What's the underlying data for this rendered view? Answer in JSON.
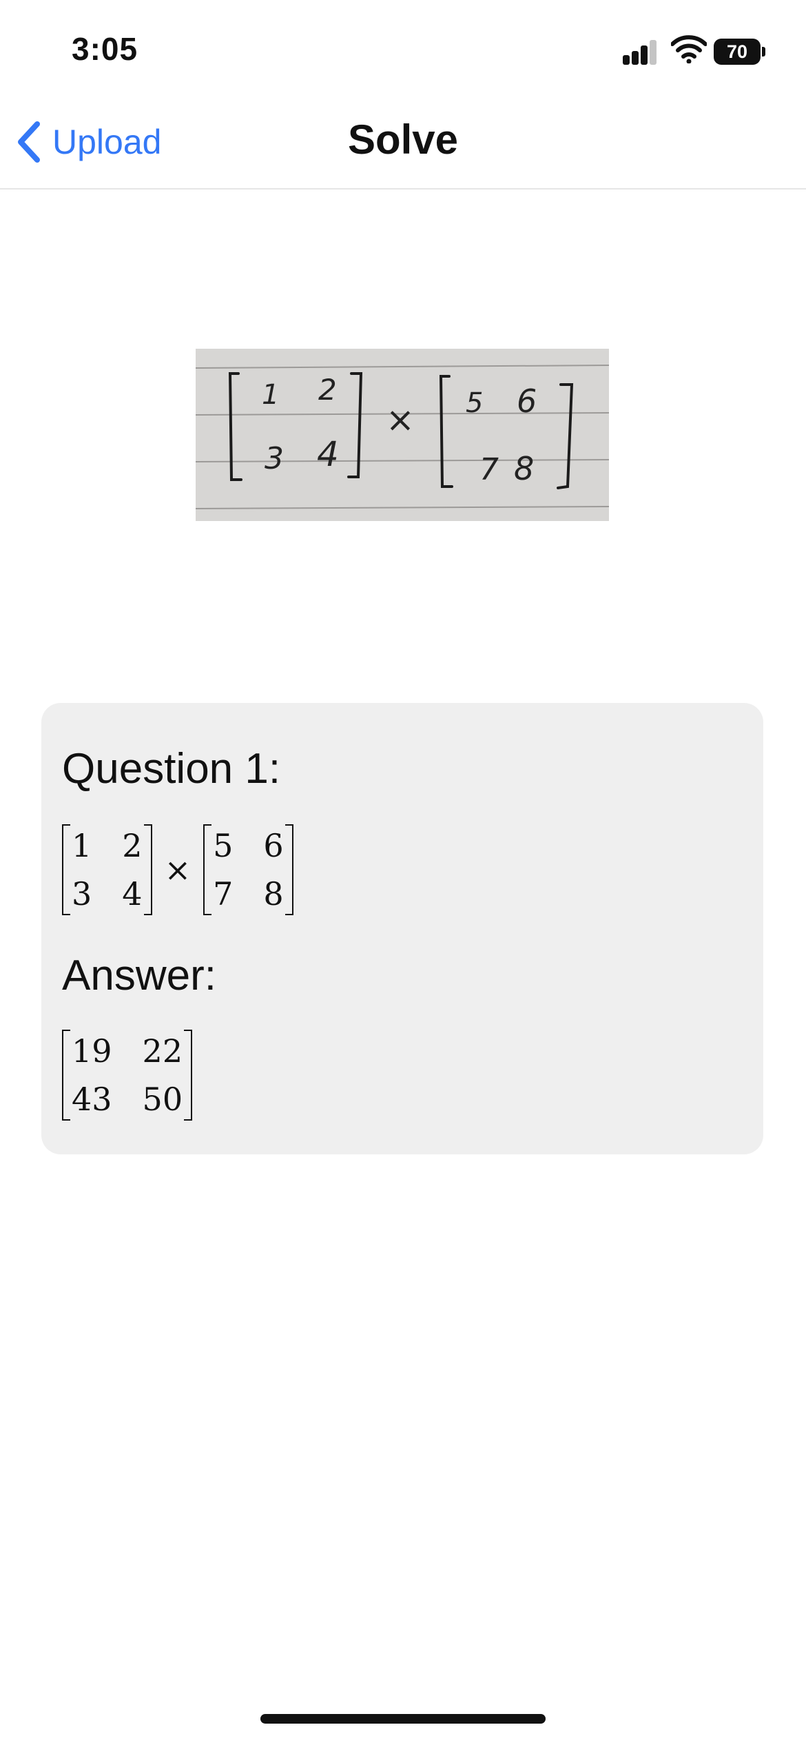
{
  "status_bar": {
    "time": "3:05",
    "battery_level": "70",
    "signal_bars_active": 3,
    "signal_bars_total": 4
  },
  "nav": {
    "back_label": "Upload",
    "title": "Solve"
  },
  "photo": {
    "matrix_a": [
      [
        "1",
        "2"
      ],
      [
        "3",
        "4"
      ]
    ],
    "operator": "×",
    "matrix_b": [
      [
        "5",
        "6"
      ],
      [
        "7",
        "8"
      ]
    ]
  },
  "result": {
    "question_label": "Question 1:",
    "question": {
      "matrix_a": [
        [
          "1",
          "2"
        ],
        [
          "3",
          "4"
        ]
      ],
      "operator": "×",
      "matrix_b": [
        [
          "5",
          "6"
        ],
        [
          "7",
          "8"
        ]
      ]
    },
    "answer_label": "Answer:",
    "answer": [
      [
        "19",
        "22"
      ],
      [
        "43",
        "50"
      ]
    ]
  },
  "colors": {
    "accent": "#3478f6",
    "card_background": "#efefef",
    "text": "#111111"
  }
}
